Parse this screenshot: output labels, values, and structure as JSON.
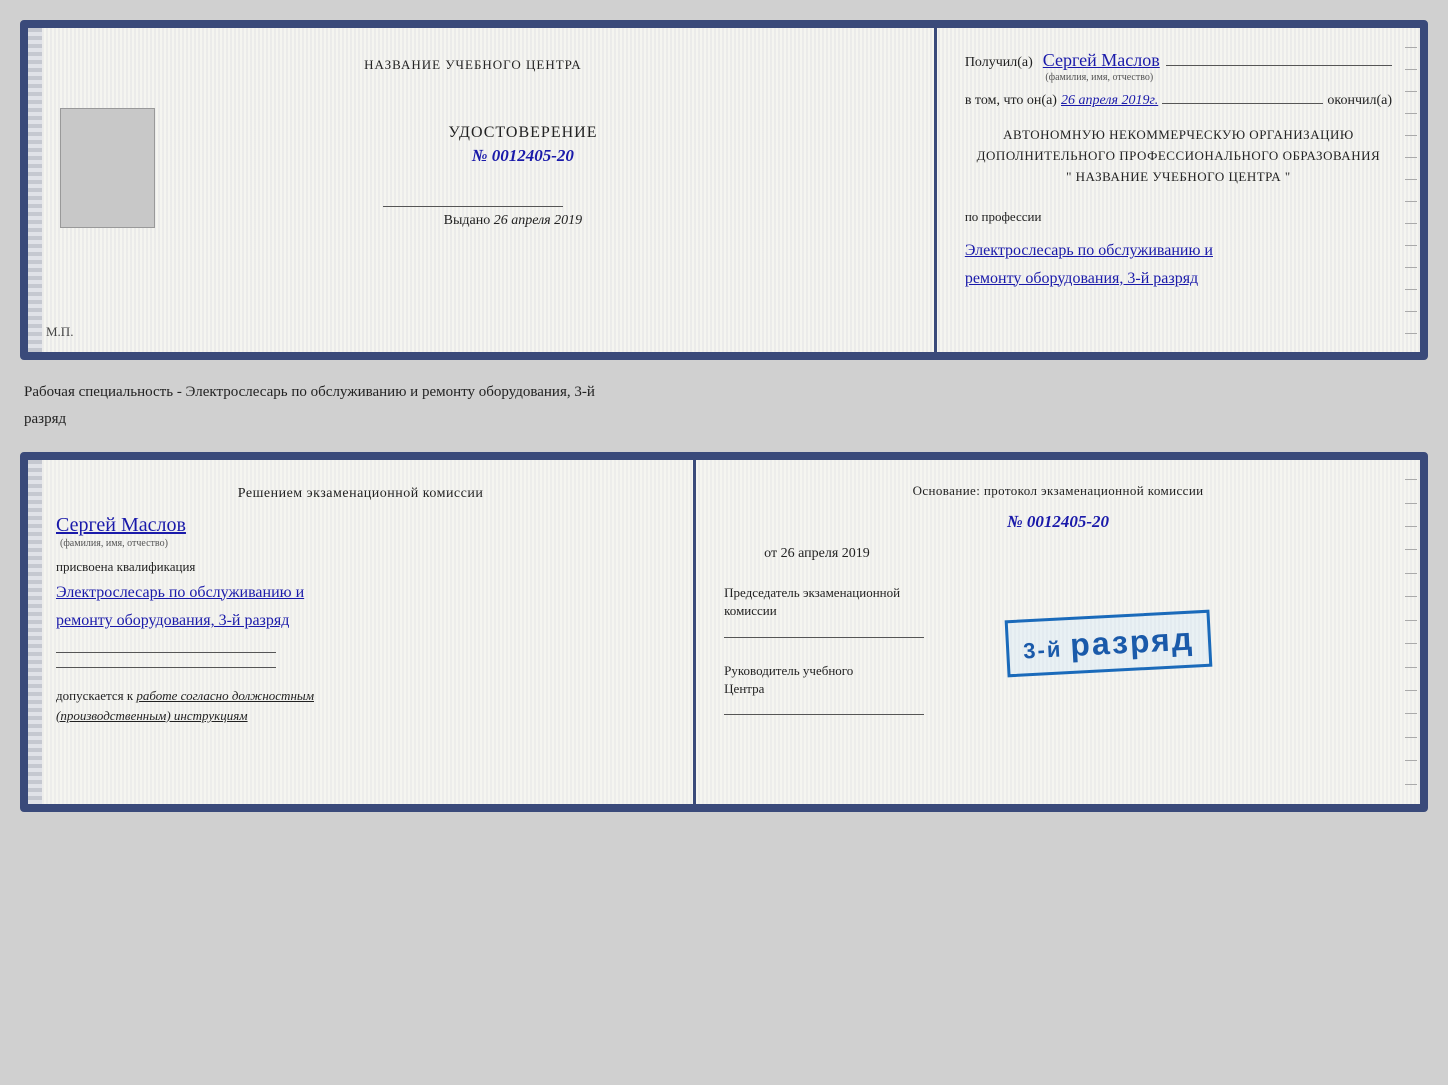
{
  "doc1": {
    "left": {
      "org_name": "НАЗВАНИЕ УЧЕБНОГО ЦЕНТРА",
      "photo_placeholder": "",
      "udostoverenie_title": "УДОСТОВЕРЕНИЕ",
      "number_label": "№",
      "number": "0012405-20",
      "signature_hint": "",
      "vydano_label": "Выдано",
      "vydano_date": "26 апреля 2019",
      "mp_label": "М.П."
    },
    "right": {
      "poluchil_label": "Получил(а)",
      "name": "Сергей Маслов",
      "fio_hint": "(фамилия, имя, отчество)",
      "vtom_label": "в том, что он(а)",
      "date_written": "26 апреля 2019г.",
      "okonchil_label": "окончил(а)",
      "org_line1": "АВТОНОМНУЮ НЕКОММЕРЧЕСКУЮ ОРГАНИЗАЦИЮ",
      "org_line2": "ДОПОЛНИТЕЛЬНОГО ПРОФЕССИОНАЛЬНОГО ОБРАЗОВАНИЯ",
      "org_line3": "\"    НАЗВАНИЕ УЧЕБНОГО ЦЕНТРА    \"",
      "poprofessii_label": "по профессии",
      "profession": "Электрослесарь по обслуживанию и\nремонту оборудования, 3-й разряд"
    }
  },
  "between": {
    "text1": "Рабочая специальность - Электрослесарь по обслуживанию и ремонту оборудования, 3-й",
    "text2": "разряд"
  },
  "doc2": {
    "left": {
      "resheniem_label": "Решением  экзаменационной  комиссии",
      "name": "Сергей Маслов",
      "fio_hint": "(фамилия, имя, отчество)",
      "prisvoena_label": "присвоена квалификация",
      "qualification": "Электрослесарь по обслуживанию и\nремонту оборудования, 3-й разряд",
      "dopuskaetsya_label": "допускается к",
      "dopuskaetsya_val": "работе согласно должностным\n(производственным) инструкциям"
    },
    "right": {
      "osnovanie_label": "Основание: протокол экзаменационной  комиссии",
      "number_label": "№",
      "number": "0012405-20",
      "ot_label": "от",
      "ot_date": "26 апреля 2019",
      "predsedatel_label": "Председатель экзаменационной\nкомиссии",
      "rukovoditel_label": "Руководитель учебного\nЦентра"
    },
    "stamp": {
      "line1": "3-й разряд"
    }
  }
}
